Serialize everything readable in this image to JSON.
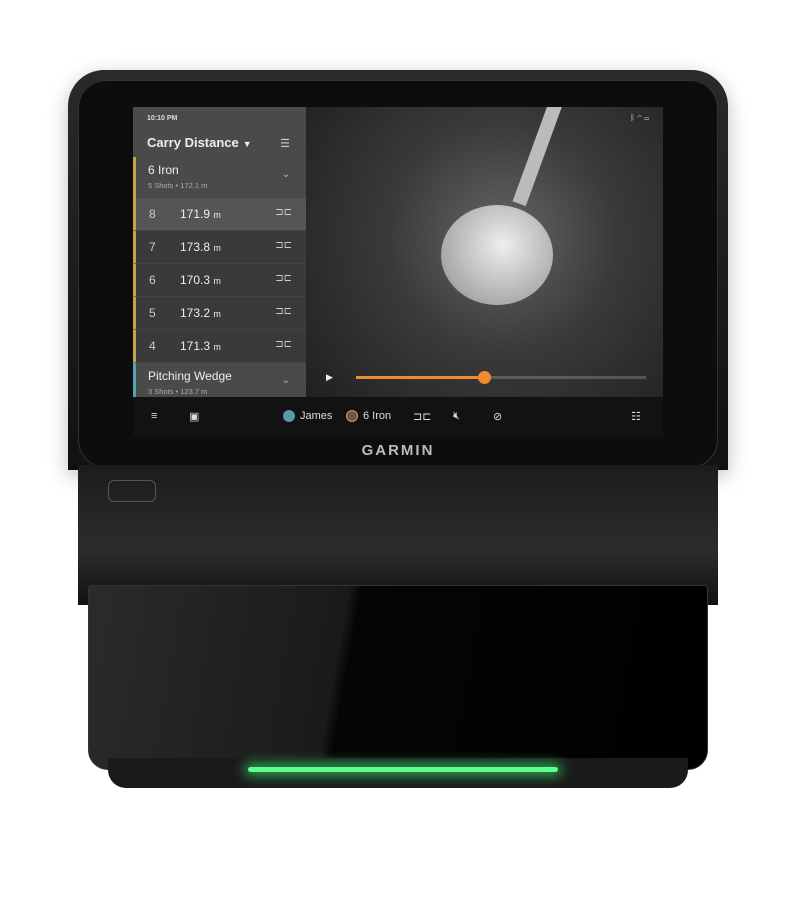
{
  "status": {
    "time": "10:10 PM",
    "icons": [
      "bluetooth-icon",
      "wifi-icon",
      "battery-icon"
    ]
  },
  "sidebar": {
    "metric": "Carry Distance",
    "groups": [
      {
        "name": "6 Iron",
        "summary": "5 Shots • 172.1 m"
      },
      {
        "name": "Pitching Wedge",
        "summary": "3 Shots • 123.7 m"
      }
    ],
    "shots": [
      {
        "num": "8",
        "value": "171.9",
        "unit": "m"
      },
      {
        "num": "7",
        "value": "173.8",
        "unit": "m"
      },
      {
        "num": "6",
        "value": "170.3",
        "unit": "m"
      },
      {
        "num": "5",
        "value": "173.2",
        "unit": "m"
      },
      {
        "num": "4",
        "value": "171.3",
        "unit": "m"
      }
    ]
  },
  "player": {
    "progress": 0.44,
    "accent": "#f08a30"
  },
  "bottombar": {
    "user": "James",
    "club": "6 Iron"
  },
  "brand": "GARMIN"
}
